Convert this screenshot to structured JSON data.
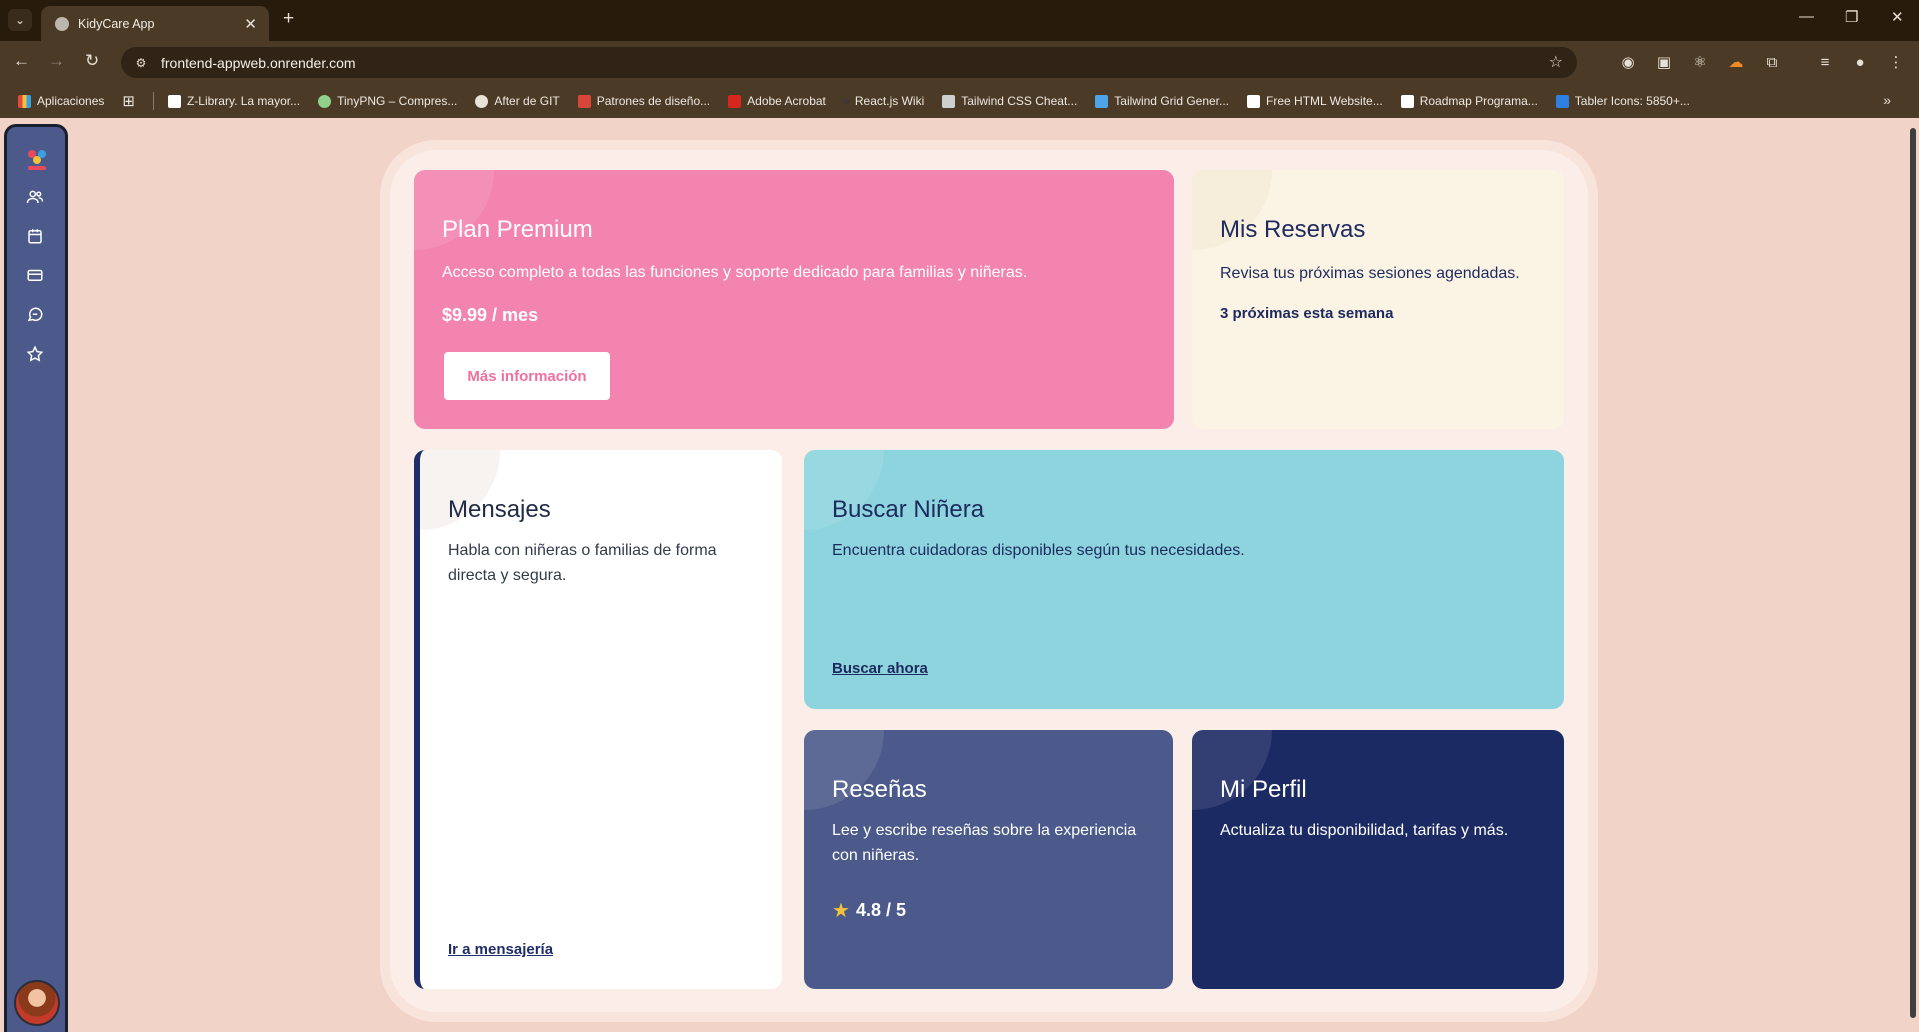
{
  "browser": {
    "tab_title": "KidyCare App",
    "url": "frontend-appweb.onrender.com",
    "bookmarks": [
      {
        "label": "Aplicaciones",
        "color": "#e14a3a"
      },
      {
        "label": "Z-Library. La mayor...",
        "color": "#ffffff"
      },
      {
        "label": "TinyPNG – Compres...",
        "color": "#8fd18a"
      },
      {
        "label": "After de GIT",
        "color": "#e9e2d8"
      },
      {
        "label": "Patrones de diseño...",
        "color": "#d8463a"
      },
      {
        "label": "Adobe Acrobat",
        "color": "#d6261e"
      },
      {
        "label": "React.js Wiki",
        "color": "#3a3a3a"
      },
      {
        "label": "Tailwind CSS Cheat...",
        "color": "#cfcfcf"
      },
      {
        "label": "Tailwind Grid Gener...",
        "color": "#4fa3e8"
      },
      {
        "label": "Free HTML Website...",
        "color": "#ffffff"
      },
      {
        "label": "Roadmap Programa...",
        "color": "#ffffff"
      },
      {
        "label": "Tabler Icons: 5850+...",
        "color": "#2f7fe0"
      }
    ]
  },
  "sidebar": {
    "items": [
      {
        "name": "users-icon"
      },
      {
        "name": "calendar-icon"
      },
      {
        "name": "credit-card-icon"
      },
      {
        "name": "messages-icon"
      },
      {
        "name": "star-icon"
      }
    ]
  },
  "cards": {
    "premium": {
      "title": "Plan Premium",
      "description": "Acceso completo a todas las funciones y soporte dedicado para familias y niñeras.",
      "price": "$9.99 / mes",
      "button": "Más información",
      "color": "#f384af"
    },
    "reservas": {
      "title": "Mis Reservas",
      "description": "Revisa tus próximas sesiones agendadas.",
      "count": "3 próximas esta semana",
      "color": "#fbf4e4"
    },
    "mensajes": {
      "title": "Mensajes",
      "description": "Habla con niñeras o familias de forma directa y segura.",
      "link": "Ir a mensajería",
      "color": "#ffffff"
    },
    "buscar": {
      "title": "Buscar Niñera",
      "description": "Encuentra cuidadoras disponibles según tus necesidades.",
      "link": "Buscar ahora",
      "color": "#8dd4de"
    },
    "resenas": {
      "title": "Reseñas",
      "description": "Lee y escribe reseñas sobre la experiencia con niñeras.",
      "rating": "4.8 / 5",
      "color": "#4b5a8a"
    },
    "perfil": {
      "title": "Mi Perfil",
      "description": "Actualiza tu disponibilidad, tarifas y más.",
      "color": "#1c2a64"
    }
  }
}
